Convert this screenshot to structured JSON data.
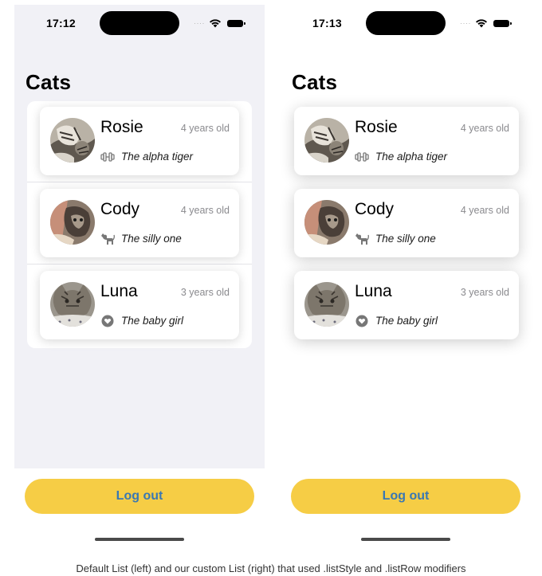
{
  "left_phone": {
    "status_time": "17:12",
    "title": "Cats",
    "cats": [
      {
        "name": "Rosie",
        "age": "4 years old",
        "icon": "dumbbell-icon",
        "description": "The alpha tiger"
      },
      {
        "name": "Cody",
        "age": "4 years old",
        "icon": "cat-icon",
        "description": "The silly one"
      },
      {
        "name": "Luna",
        "age": "3 years old",
        "icon": "heart-circle-icon",
        "description": "The baby girl"
      }
    ],
    "logout_label": "Log out"
  },
  "right_phone": {
    "status_time": "17:13",
    "title": "Cats",
    "cats": [
      {
        "name": "Rosie",
        "age": "4 years old",
        "icon": "dumbbell-icon",
        "description": "The alpha tiger"
      },
      {
        "name": "Cody",
        "age": "4 years old",
        "icon": "cat-icon",
        "description": "The silly one"
      },
      {
        "name": "Luna",
        "age": "3 years old",
        "icon": "heart-circle-icon",
        "description": "The baby girl"
      }
    ],
    "logout_label": "Log out"
  },
  "caption": "Default List (left) and our custom List (right) that used .listStyle and .listRow modifiers",
  "colors": {
    "button": "#f6cd45",
    "button_text": "#3a78b3",
    "left_background": "#f1f1f6",
    "right_background": "#ffffff"
  }
}
